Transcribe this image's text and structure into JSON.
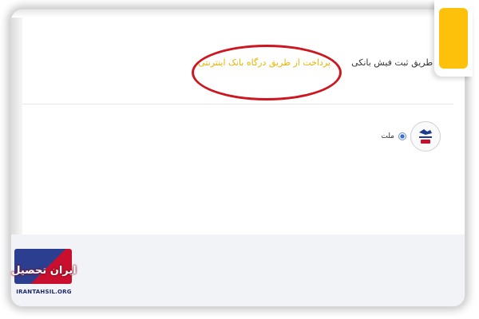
{
  "tabs": {
    "bank_receipt": "از طریق ثبت فیش بانکی",
    "internet_gateway": "پرداخت از طریق درگاه بانک اینترنتی"
  },
  "gateway": {
    "label": "ملت",
    "logo_text": "بانک ملت",
    "selected": true
  },
  "watermark": {
    "brand": "ایران تحصیل",
    "url": "IRANTAHSIL.ORG"
  },
  "colors": {
    "highlight_ring": "#cc1620",
    "active_tab_text": "#e7b400",
    "accent_card": "#fec10b",
    "watermark_blue": "#2c3e8f",
    "watermark_red": "#c8102e"
  }
}
